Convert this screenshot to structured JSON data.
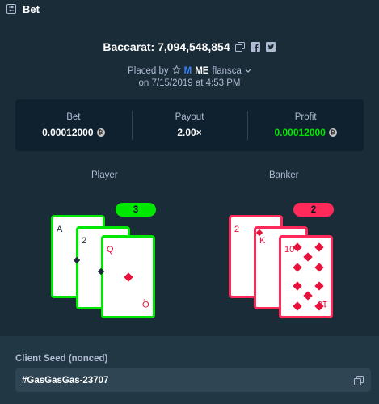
{
  "window": {
    "title": "Bet"
  },
  "bet_header": {
    "game": "Baccarat: 7,094,548,854"
  },
  "placed": {
    "prefix": "Placed by",
    "vip_badge": "M",
    "username_tag": "ME",
    "username": "flansca",
    "date": "on 7/15/2019 at 4:53 PM"
  },
  "stats": {
    "bet_label": "Bet",
    "bet_value": "0.00012000",
    "payout_label": "Payout",
    "payout_value": "2.00×",
    "profit_label": "Profit",
    "profit_value": "0.00012000",
    "currency_symbol": "₿"
  },
  "player": {
    "label": "Player",
    "score": "3",
    "cards": [
      {
        "rank": "A",
        "suit": "spades",
        "color": "dark"
      },
      {
        "rank": "2",
        "suit": "spades",
        "color": "dark"
      },
      {
        "rank": "Q",
        "suit": "diamonds",
        "color": "red"
      }
    ]
  },
  "banker": {
    "label": "Banker",
    "score": "2",
    "cards": [
      {
        "rank": "2",
        "suit": "diamonds",
        "color": "red"
      },
      {
        "rank": "K",
        "suit": "diamonds",
        "color": "red"
      },
      {
        "rank": "10",
        "suit": "diamonds",
        "color": "red"
      }
    ]
  },
  "client_seed": {
    "label": "Client Seed (nonced)",
    "value": "#GasGasGas-23707"
  },
  "colors": {
    "background": "#1a2c38",
    "panel": "#0f212e",
    "player_accent": "#00e701",
    "banker_accent": "#ff2a5a"
  },
  "icons": [
    "bet-slip-icon",
    "copy-icon",
    "facebook-icon",
    "twitter-icon",
    "star-icon",
    "chevron-down-icon",
    "bitcoin-icon"
  ]
}
